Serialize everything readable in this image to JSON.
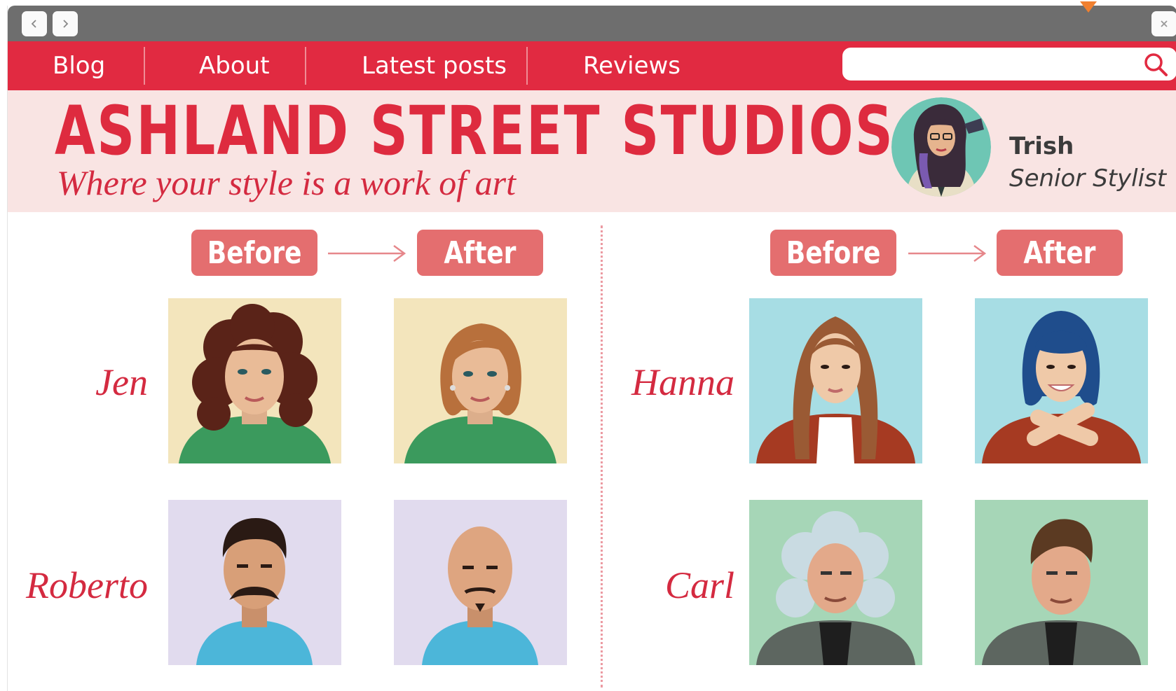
{
  "window": {
    "back_icon": "chevron-left-icon",
    "forward_icon": "chevron-right-icon",
    "close_icon": "close-icon"
  },
  "nav": {
    "items": [
      {
        "label": "Blog"
      },
      {
        "label": "About"
      },
      {
        "label": "Latest posts"
      },
      {
        "label": "Reviews"
      }
    ],
    "search": {
      "placeholder": "",
      "value": "",
      "icon": "search-icon"
    }
  },
  "header": {
    "title": "ASHLAND STREET STUDIOS",
    "tagline": "Where your style is a work of art",
    "stylist": {
      "name": "Trish",
      "role": "Senior Stylist"
    }
  },
  "columns": [
    {
      "before_label": "Before",
      "after_label": "After",
      "clients": [
        {
          "name": "Jen"
        },
        {
          "name": "Roberto"
        }
      ]
    },
    {
      "before_label": "Before",
      "after_label": "After",
      "clients": [
        {
          "name": "Hanna"
        },
        {
          "name": "Carl"
        }
      ]
    }
  ],
  "colors": {
    "brand_red": "#e12a41",
    "banner_bg": "#f9e4e3",
    "pill": "#e46e6f",
    "titlebar": "#6e6e6e"
  }
}
